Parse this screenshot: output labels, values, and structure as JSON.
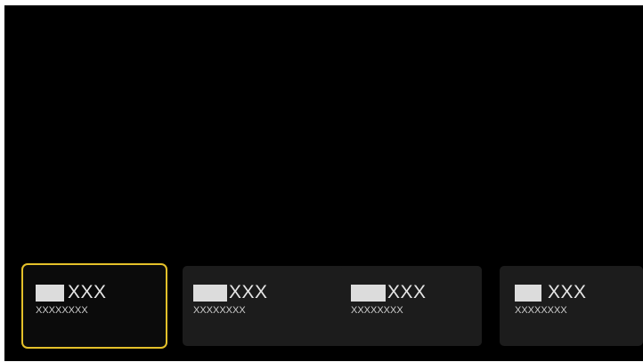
{
  "screen": {
    "background": "#000000",
    "focus_color": "#e5c12a",
    "cards": [
      {
        "icon": "input-source-icon",
        "title": "XXX",
        "subtitle": "XXXXXXXX",
        "focused": true
      },
      {
        "icon": "input-source-icon",
        "title": "XXX",
        "subtitle": "XXXXXXXX",
        "focused": false
      },
      {
        "icon": "input-source-icon",
        "title": "XXX",
        "subtitle": "XXXXXXXX",
        "focused": false
      },
      {
        "icon": "input-source-icon",
        "title": "XXX",
        "subtitle": "XXXXXXXX",
        "focused": false
      }
    ]
  }
}
